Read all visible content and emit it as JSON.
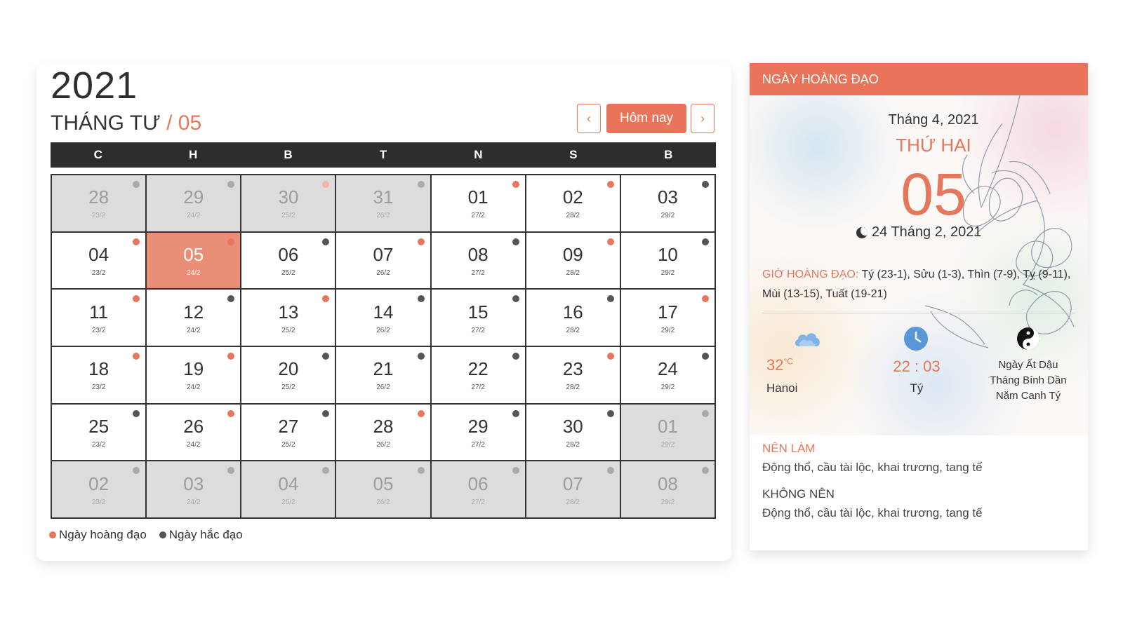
{
  "calendar": {
    "year": "2021",
    "month_name": "THÁNG TƯ",
    "month_sep": "/",
    "month_num": "05",
    "prev_label": "‹",
    "next_label": "›",
    "today_label": "Hôm nay",
    "weekdays": [
      "C",
      "H",
      "B",
      "T",
      "N",
      "S",
      "B"
    ],
    "cells": [
      {
        "day": "28",
        "lunar": "23/2",
        "other": true,
        "dot": "dark"
      },
      {
        "day": "29",
        "lunar": "24/2",
        "other": true,
        "dot": "dark"
      },
      {
        "day": "30",
        "lunar": "25/2",
        "other": true,
        "dot": "good"
      },
      {
        "day": "31",
        "lunar": "26/2",
        "other": true,
        "dot": "dark"
      },
      {
        "day": "01",
        "lunar": "27/2",
        "other": false,
        "dot": "good"
      },
      {
        "day": "02",
        "lunar": "28/2",
        "other": false,
        "dot": "good"
      },
      {
        "day": "03",
        "lunar": "29/2",
        "other": false,
        "dot": "dark"
      },
      {
        "day": "04",
        "lunar": "23/2",
        "other": false,
        "dot": "good"
      },
      {
        "day": "05",
        "lunar": "24/2",
        "other": false,
        "dot": "good",
        "selected": true
      },
      {
        "day": "06",
        "lunar": "25/2",
        "other": false,
        "dot": "dark"
      },
      {
        "day": "07",
        "lunar": "26/2",
        "other": false,
        "dot": "good"
      },
      {
        "day": "08",
        "lunar": "27/2",
        "other": false,
        "dot": "dark"
      },
      {
        "day": "09",
        "lunar": "28/2",
        "other": false,
        "dot": "good"
      },
      {
        "day": "10",
        "lunar": "29/2",
        "other": false,
        "dot": "dark"
      },
      {
        "day": "11",
        "lunar": "23/2",
        "other": false,
        "dot": "good"
      },
      {
        "day": "12",
        "lunar": "24/2",
        "other": false,
        "dot": "dark"
      },
      {
        "day": "13",
        "lunar": "25/2",
        "other": false,
        "dot": "good"
      },
      {
        "day": "14",
        "lunar": "26/2",
        "other": false,
        "dot": "dark"
      },
      {
        "day": "15",
        "lunar": "27/2",
        "other": false,
        "dot": "dark"
      },
      {
        "day": "16",
        "lunar": "28/2",
        "other": false,
        "dot": "dark"
      },
      {
        "day": "17",
        "lunar": "29/2",
        "other": false,
        "dot": "good"
      },
      {
        "day": "18",
        "lunar": "23/2",
        "other": false,
        "dot": "good"
      },
      {
        "day": "19",
        "lunar": "24/2",
        "other": false,
        "dot": "good"
      },
      {
        "day": "20",
        "lunar": "25/2",
        "other": false,
        "dot": "dark"
      },
      {
        "day": "21",
        "lunar": "26/2",
        "other": false,
        "dot": "dark"
      },
      {
        "day": "22",
        "lunar": "27/2",
        "other": false,
        "dot": "dark"
      },
      {
        "day": "23",
        "lunar": "28/2",
        "other": false,
        "dot": "good"
      },
      {
        "day": "24",
        "lunar": "29/2",
        "other": false,
        "dot": "dark"
      },
      {
        "day": "25",
        "lunar": "23/2",
        "other": false,
        "dot": "dark"
      },
      {
        "day": "26",
        "lunar": "24/2",
        "other": false,
        "dot": "good"
      },
      {
        "day": "27",
        "lunar": "25/2",
        "other": false,
        "dot": "dark"
      },
      {
        "day": "28",
        "lunar": "26/2",
        "other": false,
        "dot": "good"
      },
      {
        "day": "29",
        "lunar": "27/2",
        "other": false,
        "dot": "dark"
      },
      {
        "day": "30",
        "lunar": "28/2",
        "other": false,
        "dot": "dark"
      },
      {
        "day": "01",
        "lunar": "29/2",
        "other": true,
        "dot": "dark"
      },
      {
        "day": "02",
        "lunar": "23/2",
        "other": true,
        "dot": "dark"
      },
      {
        "day": "03",
        "lunar": "24/2",
        "other": true,
        "dot": "dark"
      },
      {
        "day": "04",
        "lunar": "25/2",
        "other": true,
        "dot": "dark"
      },
      {
        "day": "05",
        "lunar": "26/2",
        "other": true,
        "dot": "dark"
      },
      {
        "day": "06",
        "lunar": "27/2",
        "other": true,
        "dot": "dark"
      },
      {
        "day": "07",
        "lunar": "28/2",
        "other": true,
        "dot": "dark"
      },
      {
        "day": "08",
        "lunar": "29/2",
        "other": true,
        "dot": "dark"
      }
    ],
    "legend": {
      "good_label": "Ngày hoàng đạo",
      "bad_label": "Ngày hắc đạo",
      "good_color": "#e5775c",
      "bad_color": "#555555"
    }
  },
  "info": {
    "header": "NGÀY HOÀNG ĐẠO",
    "month_label": "Tháng 4, 2021",
    "day_of_week": "THỨ HAI",
    "day_number": "05",
    "lunar_date": "24 Tháng 2, 2021",
    "gio_label": "GIỜ HOÀNG ĐẠO:",
    "gio_value": " Tý (23-1), Sửu (1-3), Thìn (7-9), Tỵ (9-11), Mùi (13-15), Tuất (19-21)",
    "weather": {
      "icon": "cloud-icon",
      "temp": "32",
      "unit": "°C",
      "city": "Hanoi"
    },
    "clock": {
      "icon": "clock-icon",
      "time": "22 : 03",
      "hour_name": "Tý"
    },
    "can_chi": {
      "icon": "yin-yang-icon",
      "line1": "Ngày Ất Dậu",
      "line2": "Tháng Bính Dần",
      "line3": "Năm Canh Tý"
    },
    "nen_lam_label": "NÊN LÀM",
    "nen_lam_value": "Động thổ, cầu tài lộc, khai trương, tang tế",
    "khong_nen_label": "KHÔNG NÊN",
    "khong_nen_value": "Động thổ, cầu tài lộc, khai trương, tang tế",
    "accent_color": "#e97459"
  }
}
